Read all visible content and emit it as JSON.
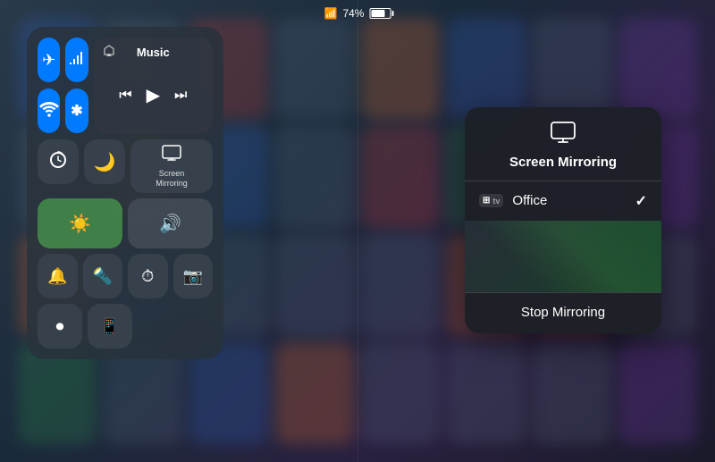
{
  "statusBar": {
    "battery": "74%",
    "wifiSymbol": "📶"
  },
  "controlCenter": {
    "buttons": {
      "airplane": "✈",
      "cellular": "📡",
      "wifi": "wifi",
      "bluetooth": "bt",
      "rotation": "🔒",
      "doNotDisturb": "🌙",
      "screenMirroring": "⊟",
      "screenMirroringLabel": "Screen\nMirroring",
      "brightness": "☀",
      "volume": "🔊",
      "bell": "🔔",
      "flashlight": "🔦",
      "timer": "⏱",
      "camera": "📷",
      "screenRecord": "⏺",
      "remote": "📱"
    },
    "music": {
      "title": "Music",
      "prev": "«",
      "play": "▶",
      "next": "»"
    }
  },
  "mirroringPanel": {
    "icon": "⊟",
    "title": "Screen Mirroring",
    "device": "Office",
    "appleTVLabel": "tv",
    "appleTVText": "Apple TV",
    "checkmark": "✓",
    "stopButton": "Stop Mirroring"
  }
}
